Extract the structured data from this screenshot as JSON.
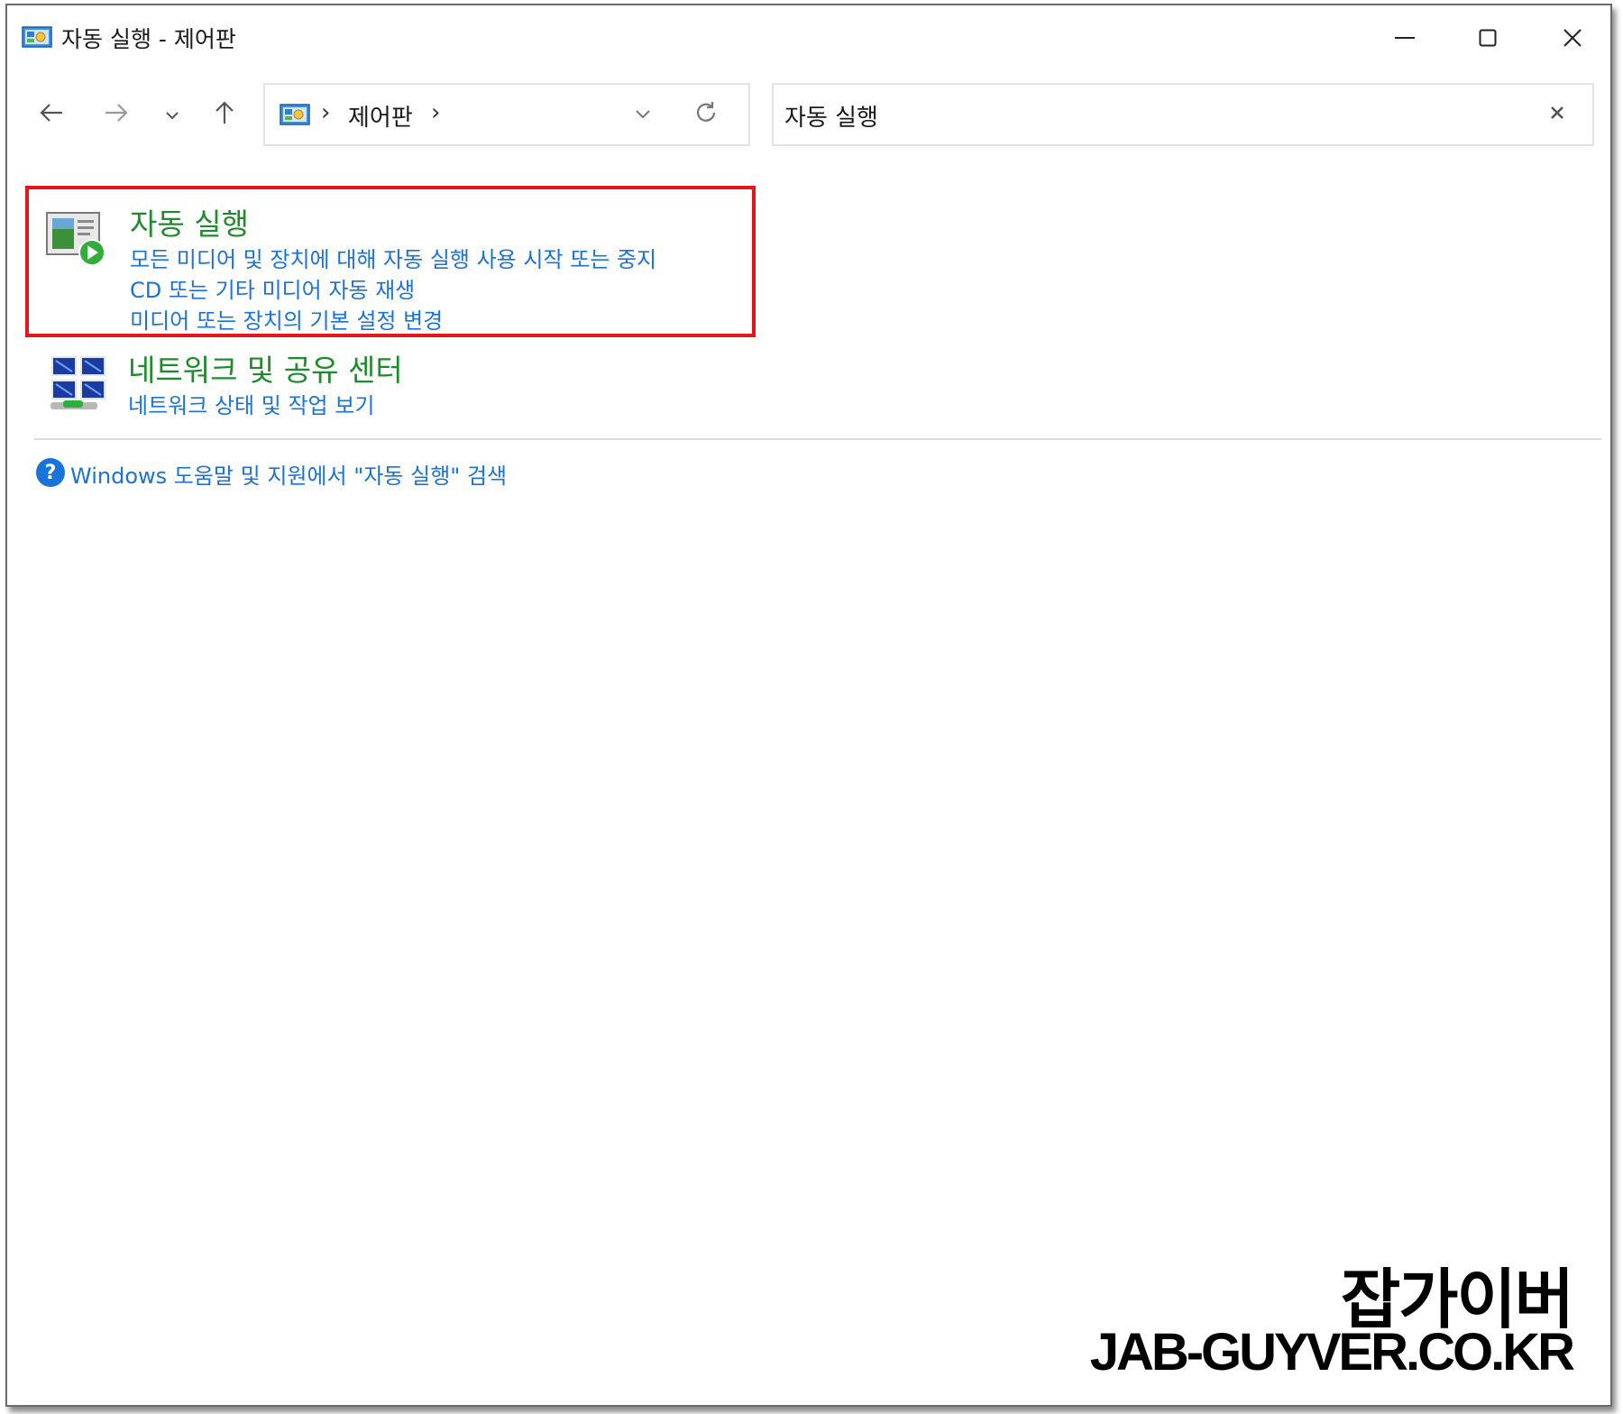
{
  "window": {
    "title": "자동 실행 - 제어판",
    "app_icon": "control-panel-icon"
  },
  "nav": {
    "back_icon": "arrow-left-icon",
    "forward_icon": "arrow-right-icon",
    "recent_icon": "chevron-down-icon",
    "up_icon": "arrow-up-icon"
  },
  "address": {
    "separator": "›",
    "crumb": "제어판",
    "trailing_separator": "›"
  },
  "search": {
    "value": "자동 실행"
  },
  "results": [
    {
      "title": "자동 실행",
      "icon": "autoplay-icon",
      "highlighted": true,
      "highlight_color": "#e8141b",
      "links": [
        "모든 미디어 및 장치에 대해 자동 실행 사용 시작 또는 중지",
        "CD 또는 기타 미디어 자동 재생",
        "미디어 또는 장치의 기본 설정 변경"
      ]
    },
    {
      "title": "네트워크 및 공유 센터",
      "icon": "network-icon",
      "links": [
        "네트워크 상태 및 작업 보기"
      ]
    }
  ],
  "help": {
    "icon": "help-icon",
    "text": "Windows 도움말 및 지원에서 \"자동 실행\" 검색"
  },
  "watermark": {
    "korean": "잡가이버",
    "url": "JAB-GUYVER.CO.KR"
  },
  "colors": {
    "title_green": "#1e8c2c",
    "link_blue": "#1a73d8",
    "highlight_red": "#e8141b"
  }
}
